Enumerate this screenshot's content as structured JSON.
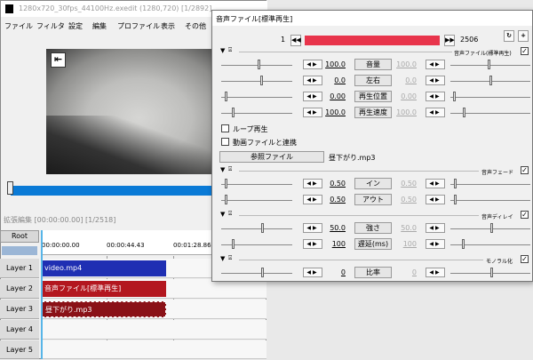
{
  "main_window": {
    "title": "1280x720_30fps_44100Hz.exedit (1280,720)  [1/2892]",
    "menu": [
      "ファイル",
      "フィルタ",
      "設定",
      "編集",
      "プロファイル",
      "表示",
      "その他"
    ]
  },
  "extended_edit": {
    "title": "拡張編集 [00:00:00.00] [1/2518]"
  },
  "timeline": {
    "root_label": "Root",
    "ticks": [
      "00:00:00.00",
      "00:00:44.43",
      "00:01:28.86"
    ],
    "layers": [
      {
        "label": "Layer 1",
        "clip": "video.mp4",
        "color": "#1f2fb3"
      },
      {
        "label": "Layer 2",
        "clip": "音声ファイル[標準再生]",
        "color": "#b3171f"
      },
      {
        "label": "Layer 3",
        "clip": "昼下がり.mp3",
        "color": "#8a1117"
      },
      {
        "label": "Layer 4",
        "clip": ""
      },
      {
        "label": "Layer 5",
        "clip": ""
      }
    ]
  },
  "dialog": {
    "title": "音声ファイル[標準再生]",
    "frame_start": "1",
    "frame_end": "2506",
    "progress_color": "#e8344b",
    "sections": {
      "audio_file": "音声ファイル(標準再生)",
      "audio_fade": "音声フェード",
      "audio_delay": "音声ディレイ",
      "mono": "モノラル化"
    },
    "params": {
      "volume": {
        "label": "音量",
        "left": "100.0",
        "right": "100.0"
      },
      "pan": {
        "label": "左右",
        "left": "0.0",
        "right": "0.0"
      },
      "position": {
        "label": "再生位置",
        "left": "0.00",
        "right": "0.00"
      },
      "speed": {
        "label": "再生速度",
        "left": "100.0",
        "right": "100.0"
      },
      "fade_in": {
        "label": "イン",
        "left": "0.50",
        "right": "0.50"
      },
      "fade_out": {
        "label": "アウト",
        "left": "0.50",
        "right": "0.50"
      },
      "strength": {
        "label": "強さ",
        "left": "50.0",
        "right": "50.0"
      },
      "delay_ms": {
        "label": "遅延(ms)",
        "left": "100",
        "right": "100"
      },
      "ratio": {
        "label": "比率",
        "left": "0",
        "right": "0"
      }
    },
    "loop_label": "ループ再生",
    "link_label": "動画ファイルと連携",
    "ref_file_button": "参照ファイル",
    "file_name": "昼下がり.mp3"
  }
}
